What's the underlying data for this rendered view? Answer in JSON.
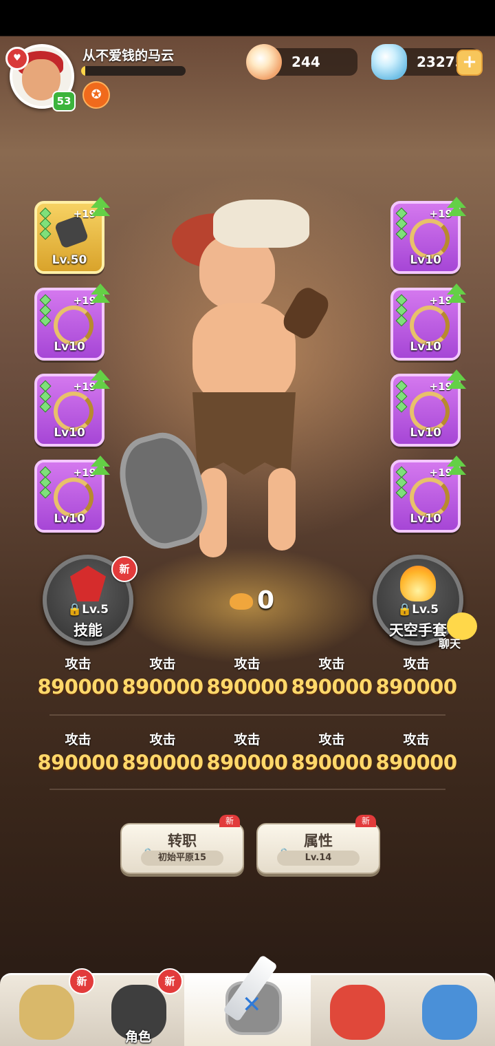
{
  "player": {
    "name": "从不爱钱的马云",
    "level": "53",
    "exp_fraction": 0.04
  },
  "currency": {
    "shells": "244",
    "gems": "23275",
    "plus_label": "+"
  },
  "equipment": {
    "left": [
      {
        "plus": "+19",
        "level": "Lv.50",
        "rarity": "gold",
        "icon": "frying-pan-icon"
      },
      {
        "plus": "+19",
        "level": "Lv10",
        "rarity": "purple",
        "icon": "bone-necklace-icon"
      },
      {
        "plus": "+19",
        "level": "Lv10",
        "rarity": "purple",
        "icon": "bone-necklace-icon"
      },
      {
        "plus": "+19",
        "level": "Lv10",
        "rarity": "purple",
        "icon": "bone-necklace-icon"
      }
    ],
    "right": [
      {
        "plus": "+19",
        "level": "Lv10",
        "rarity": "purple",
        "icon": "bone-necklace-icon"
      },
      {
        "plus": "+19",
        "level": "Lv10",
        "rarity": "purple",
        "icon": "bone-necklace-icon"
      },
      {
        "plus": "+19",
        "level": "Lv10",
        "rarity": "purple",
        "icon": "bone-necklace-icon"
      },
      {
        "plus": "+19",
        "level": "Lv10",
        "rarity": "purple",
        "icon": "bone-necklace-icon"
      }
    ]
  },
  "features": {
    "skill": {
      "lock_level": "Lv.5",
      "label": "技能",
      "badge": "新"
    },
    "sky": {
      "lock_level": "Lv.5",
      "label": "天空手套"
    }
  },
  "power": "0",
  "chat_label": "聊天",
  "stats": [
    [
      {
        "label": "攻击",
        "value": "890000"
      },
      {
        "label": "攻击",
        "value": "890000"
      },
      {
        "label": "攻击",
        "value": "890000"
      },
      {
        "label": "攻击",
        "value": "890000"
      },
      {
        "label": "攻击",
        "value": "890000"
      }
    ],
    [
      {
        "label": "攻击",
        "value": "890000"
      },
      {
        "label": "攻击",
        "value": "890000"
      },
      {
        "label": "攻击",
        "value": "890000"
      },
      {
        "label": "攻击",
        "value": "890000"
      },
      {
        "label": "攻击",
        "value": "890000"
      }
    ]
  ],
  "actions": {
    "job": {
      "title": "转职",
      "sub": "初始平原15",
      "badge": "新"
    },
    "attr": {
      "title": "属性",
      "sub": "Lv.14",
      "badge": "新"
    }
  },
  "tabs": [
    {
      "label": "",
      "badge": "新",
      "icon": "caveman-icon"
    },
    {
      "label": "角色",
      "badge": "新",
      "icon": "character-icon"
    },
    {
      "label": "",
      "badge": "",
      "icon": "sword-stone-icon"
    },
    {
      "label": "",
      "badge": "",
      "icon": "dino-pet-icon"
    },
    {
      "label": "",
      "badge": "",
      "icon": "portal-icon"
    }
  ],
  "colors": {
    "gold": "#ffd86a",
    "purple_slot": "#b85ee0",
    "new_badge": "#e23b3b",
    "level_green": "#3cb43c"
  }
}
